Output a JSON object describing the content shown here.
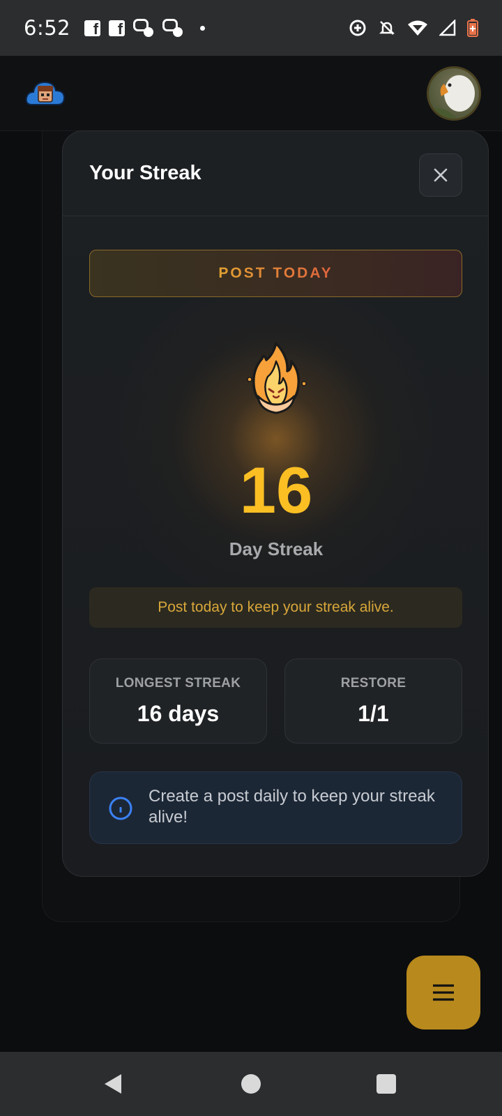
{
  "status_bar": {
    "time": "6:52",
    "left_icons": [
      "facebook-icon",
      "facebook-icon",
      "messenger-icon",
      "messenger-icon",
      "notification-dot"
    ],
    "right_icons": [
      "data-saver-icon",
      "do-not-disturb-icon",
      "wifi-icon",
      "cell-signal-icon",
      "battery-icon"
    ]
  },
  "header": {
    "logo_icon": "cloud-character-logo",
    "avatar_icon": "goose-avatar"
  },
  "modal": {
    "title": "Your Streak",
    "close_icon": "close-icon",
    "post_today_label": "POST TODAY",
    "flame_icon": "flame-icon",
    "streak_count": "16",
    "streak_label": "Day Streak",
    "hint": "Post today to keep your streak alive.",
    "stats": [
      {
        "label": "LONGEST STREAK",
        "value": "16 days"
      },
      {
        "label": "RESTORE",
        "value": "1/1"
      }
    ],
    "info_icon": "info-icon",
    "info_text": "Create a post daily to keep your streak alive!"
  },
  "fab": {
    "icon": "menu-icon"
  },
  "nav": {
    "back": "back-icon",
    "home": "home-icon",
    "recents": "recents-icon"
  },
  "colors": {
    "accent_gold": "#fbbf24",
    "fab": "#b8891c",
    "info_blue": "#3b82f6",
    "modal_bg": "#1c1e21"
  }
}
